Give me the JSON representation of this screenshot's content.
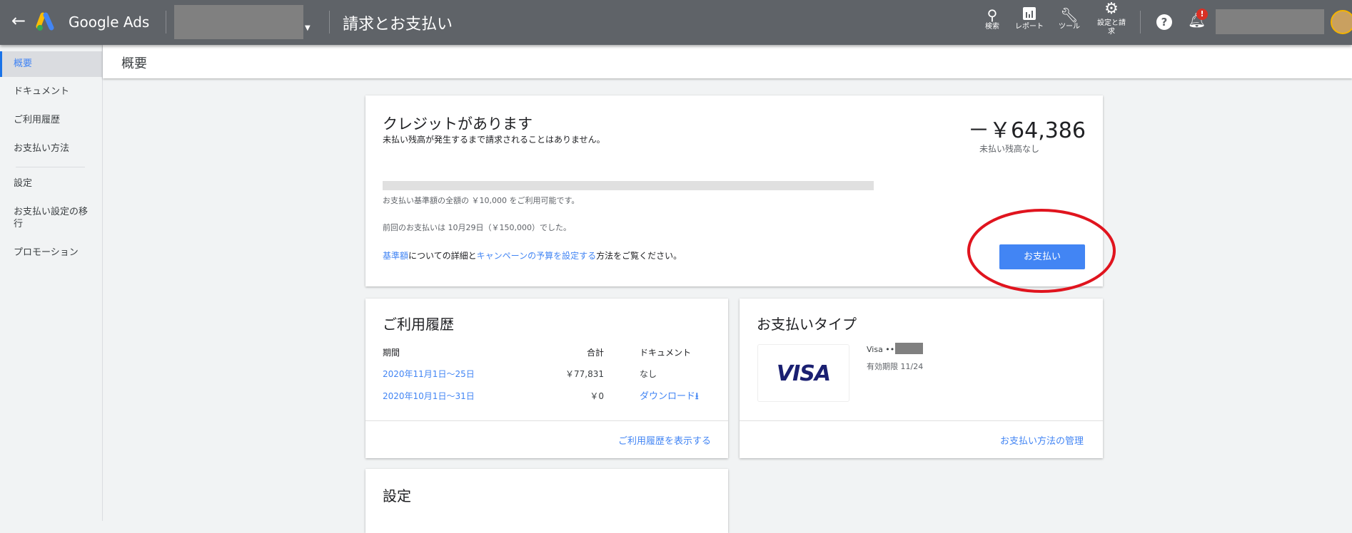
{
  "header": {
    "brand": "Google Ads",
    "page_title": "請求とお支払い",
    "tools": [
      {
        "icon": "search-icon",
        "label": "検索"
      },
      {
        "icon": "report-icon",
        "label": "レポート"
      },
      {
        "icon": "wrench-icon",
        "label": "ツール"
      },
      {
        "icon": "gear-icon",
        "label": "設定と請求"
      }
    ],
    "notification_badge": "!"
  },
  "sidebar": {
    "items": [
      {
        "label": "概要",
        "active": true
      },
      {
        "label": "ドキュメント"
      },
      {
        "label": "ご利用履歴"
      },
      {
        "label": "お支払い方法"
      },
      {
        "label": "設定"
      },
      {
        "label": "お支払い設定の移行"
      },
      {
        "label": "プロモーション"
      }
    ]
  },
  "subheader": {
    "title": "概要"
  },
  "overview": {
    "title": "クレジットがあります",
    "subtitle": "未払い残高が発生するまで請求されることはありません。",
    "amount": "－￥64,386",
    "amount_note": "未払い残高なし",
    "available_text": "お支払い基準額の全額の ￥10,000 をご利用可能です。",
    "last_payment": "前回のお支払いは 10月29日（￥150,000）でした。",
    "info_link1": "基準額",
    "info_text1": "についての詳細と",
    "info_link2": "キャンペーンの予算を設定する",
    "info_text2": "方法をご覧ください。",
    "pay_button": "お支払い",
    "highlight_color": "#e0141e"
  },
  "usage": {
    "title": "ご利用履歴",
    "columns": [
      "期間",
      "合計",
      "ドキュメント"
    ],
    "rows": [
      {
        "period": "2020年11月1日～25日",
        "total": "￥77,831",
        "document": "なし"
      },
      {
        "period": "2020年10月1日～31日",
        "total": "￥0",
        "document": "ダウンロード"
      }
    ],
    "footer_link": "ご利用履歴を表示する"
  },
  "payment_type": {
    "title": "お支払いタイプ",
    "card_brand": "VISA",
    "card_label": "Visa ••••",
    "expiry": "有効期限 11/24",
    "footer_link": "お支払い方法の管理"
  },
  "settings": {
    "title": "設定"
  },
  "colors": {
    "accent": "#4285f4",
    "topbar": "#5f6368"
  }
}
